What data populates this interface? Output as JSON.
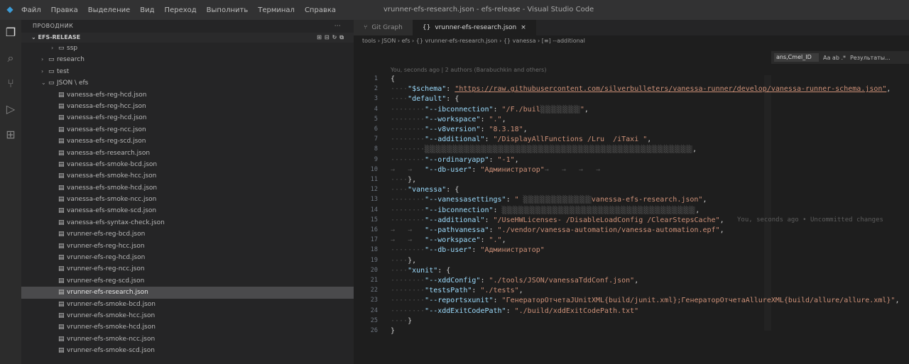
{
  "window": {
    "menu": [
      "Файл",
      "Правка",
      "Выделение",
      "Вид",
      "Переход",
      "Выполнить",
      "Терминал",
      "Справка"
    ],
    "title": "vrunner-efs-research.json - efs-release - Visual Studio Code"
  },
  "sidebar": {
    "title": "ПРОВОДНИК",
    "dots": "···",
    "section": "EFS-RELEASE",
    "section_actions": "⊞⊟↻⧉",
    "items": [
      {
        "label": "ssp",
        "indent": 2,
        "type": "folder"
      },
      {
        "label": "research",
        "indent": 1,
        "type": "folder"
      },
      {
        "label": "test",
        "indent": 1,
        "type": "folder"
      },
      {
        "label": "JSON \\ efs",
        "indent": 1,
        "type": "folder-open"
      },
      {
        "label": "vanessa-efs-reg-hcd.json",
        "indent": 2,
        "type": "file"
      },
      {
        "label": "vanessa-efs-reg-hcc.json",
        "indent": 2,
        "type": "file"
      },
      {
        "label": "vanessa-efs-reg-hcd.json",
        "indent": 2,
        "type": "file"
      },
      {
        "label": "vanessa-efs-reg-ncc.json",
        "indent": 2,
        "type": "file"
      },
      {
        "label": "vanessa-efs-reg-scd.json",
        "indent": 2,
        "type": "file"
      },
      {
        "label": "vanessa-efs-research.json",
        "indent": 2,
        "type": "file"
      },
      {
        "label": "vanessa-efs-smoke-bcd.json",
        "indent": 2,
        "type": "file"
      },
      {
        "label": "vanessa-efs-smoke-hcc.json",
        "indent": 2,
        "type": "file"
      },
      {
        "label": "vanessa-efs-smoke-hcd.json",
        "indent": 2,
        "type": "file"
      },
      {
        "label": "vanessa-efs-smoke-ncc.json",
        "indent": 2,
        "type": "file"
      },
      {
        "label": "vanessa-efs-smoke-scd.json",
        "indent": 2,
        "type": "file"
      },
      {
        "label": "vanessa-efs-syntax-check.json",
        "indent": 2,
        "type": "file"
      },
      {
        "label": "vrunner-efs-reg-bcd.json",
        "indent": 2,
        "type": "file"
      },
      {
        "label": "vrunner-efs-reg-hcc.json",
        "indent": 2,
        "type": "file"
      },
      {
        "label": "vrunner-efs-reg-hcd.json",
        "indent": 2,
        "type": "file"
      },
      {
        "label": "vrunner-efs-reg-ncc.json",
        "indent": 2,
        "type": "file"
      },
      {
        "label": "vrunner-efs-reg-scd.json",
        "indent": 2,
        "type": "file"
      },
      {
        "label": "vrunner-efs-research.json",
        "indent": 2,
        "type": "file",
        "selected": true
      },
      {
        "label": "vrunner-efs-smoke-bcd.json",
        "indent": 2,
        "type": "file"
      },
      {
        "label": "vrunner-efs-smoke-hcc.json",
        "indent": 2,
        "type": "file"
      },
      {
        "label": "vrunner-efs-smoke-hcd.json",
        "indent": 2,
        "type": "file"
      },
      {
        "label": "vrunner-efs-smoke-ncc.json",
        "indent": 2,
        "type": "file"
      },
      {
        "label": "vrunner-efs-smoke-scd.json",
        "indent": 2,
        "type": "file"
      }
    ]
  },
  "tabs": [
    {
      "label": "Git Graph",
      "active": false
    },
    {
      "label": "vrunner-efs-research.json",
      "active": true
    }
  ],
  "breadcrumb": "tools › JSON › efs › {} vrunner-efs-research.json › {} vanessa › [≡] --additional",
  "find": {
    "value": "ans,Cmel_ID",
    "options": "Aa ab .*",
    "right": "Результаты..."
  },
  "blame_header": "You, seconds ago | 2 authors (Barabuchkin and others)",
  "blame_line15": "You, seconds ago • Uncommitted changes",
  "code": [
    [
      [
        "p",
        "{"
      ]
    ],
    [
      [
        "w",
        "····"
      ],
      [
        "k",
        "\"$schema\""
      ],
      [
        "p",
        ": "
      ],
      [
        "url",
        "\"https://raw.githubusercontent.com/silverbulleters/vanessa-runner/develop/vanessa-runner-schema.json\""
      ],
      [
        "p",
        ","
      ]
    ],
    [
      [
        "w",
        "····"
      ],
      [
        "k",
        "\"default\""
      ],
      [
        "p",
        ": {"
      ]
    ],
    [
      [
        "w",
        "········"
      ],
      [
        "k",
        "\"--ibconnection\""
      ],
      [
        "p",
        ": "
      ],
      [
        "s",
        "\"/F./buil"
      ],
      [
        "blur",
        "░░░░░░░"
      ],
      [
        "s",
        "\""
      ],
      [
        "p",
        ","
      ]
    ],
    [
      [
        "w",
        "········"
      ],
      [
        "k",
        "\"--workspace\""
      ],
      [
        "p",
        ": "
      ],
      [
        "s",
        "\".\""
      ],
      [
        "p",
        ","
      ]
    ],
    [
      [
        "w",
        "········"
      ],
      [
        "k",
        "\"--v8version\""
      ],
      [
        "p",
        ": "
      ],
      [
        "s",
        "\"8.3.18\""
      ],
      [
        "p",
        ","
      ]
    ],
    [
      [
        "w",
        "········"
      ],
      [
        "k",
        "\"--additional\""
      ],
      [
        "p",
        ": "
      ],
      [
        "s",
        "\"/DisplayAllFunctions /Lru  /iTaxi \""
      ],
      [
        "p",
        ","
      ]
    ],
    [
      [
        "w",
        "········"
      ],
      [
        "blur",
        "░░░░░░░░░░░░░░░░░░░░░░░░░░░░░░░░░░░░░░░░░░░░░░░"
      ],
      [
        "p",
        ","
      ]
    ],
    [
      [
        "w",
        "········"
      ],
      [
        "k",
        "\"--ordinaryapp\""
      ],
      [
        "p",
        ": "
      ],
      [
        "s",
        "\"-1\""
      ],
      [
        "p",
        ","
      ]
    ],
    [
      [
        "w",
        "→   →   "
      ],
      [
        "k",
        "\"--db-user\""
      ],
      [
        "p",
        ": "
      ],
      [
        "s",
        "\"Администратор\""
      ],
      [
        "w",
        "→   →   →   →"
      ]
    ],
    [
      [
        "w",
        "····"
      ],
      [
        "p",
        "},"
      ]
    ],
    [
      [
        "w",
        "····"
      ],
      [
        "k",
        "\"vanessa\""
      ],
      [
        "p",
        ": {"
      ]
    ],
    [
      [
        "w",
        "········"
      ],
      [
        "k",
        "\"--vanessasettings\""
      ],
      [
        "p",
        ": "
      ],
      [
        "s",
        "\" "
      ],
      [
        "blur",
        "░░░░░░░░░░░░"
      ],
      [
        "s",
        "vanessa-efs-research.json\""
      ],
      [
        "p",
        ","
      ]
    ],
    [
      [
        "w",
        "········"
      ],
      [
        "k",
        "\"--ibconnection\""
      ],
      [
        "p",
        ": "
      ],
      [
        "blur",
        "░░░░░░░░░░░░░░░░░░░░░░░░░░░░░░░░░░"
      ],
      [
        "p",
        ","
      ]
    ],
    [
      [
        "w",
        "········"
      ],
      [
        "k",
        "\"--additional\""
      ],
      [
        "p",
        ": "
      ],
      [
        "s",
        "\"/UseHWLicenses- /DisableLoadConfig /ClearStepsCache\""
      ],
      [
        "p",
        ","
      ]
    ],
    [
      [
        "w",
        "→   →   "
      ],
      [
        "k",
        "\"--pathvanessa\""
      ],
      [
        "p",
        ": "
      ],
      [
        "s",
        "\"./vendor/vanessa-automation/vanessa-automation.epf\""
      ],
      [
        "p",
        ","
      ]
    ],
    [
      [
        "w",
        "→   →   "
      ],
      [
        "k",
        "\"--workspace\""
      ],
      [
        "p",
        ": "
      ],
      [
        "s",
        "\".\""
      ],
      [
        "p",
        ","
      ]
    ],
    [
      [
        "w",
        "········"
      ],
      [
        "k",
        "\"--db-user\""
      ],
      [
        "p",
        ": "
      ],
      [
        "s",
        "\"Администратор\""
      ]
    ],
    [
      [
        "w",
        "····"
      ],
      [
        "p",
        "},"
      ]
    ],
    [
      [
        "w",
        "····"
      ],
      [
        "k",
        "\"xunit\""
      ],
      [
        "p",
        ": {"
      ]
    ],
    [
      [
        "w",
        "········"
      ],
      [
        "k",
        "\"--xddConfig\""
      ],
      [
        "p",
        ": "
      ],
      [
        "s",
        "\"./tools/JSON/vanessaTddConf.json\""
      ],
      [
        "p",
        ","
      ]
    ],
    [
      [
        "w",
        "········"
      ],
      [
        "k",
        "\"testsPath\""
      ],
      [
        "p",
        ": "
      ],
      [
        "s",
        "\"./tests\""
      ],
      [
        "p",
        ","
      ]
    ],
    [
      [
        "w",
        "········"
      ],
      [
        "k",
        "\"--reportsxunit\""
      ],
      [
        "p",
        ": "
      ],
      [
        "s",
        "\"ГенераторОтчетаJUnitXML{build/junit.xml};ГенераторОтчетаAllureXML{build/allure/allure.xml}\""
      ],
      [
        "p",
        ","
      ]
    ],
    [
      [
        "w",
        "········"
      ],
      [
        "k",
        "\"--xddExitCodePath\""
      ],
      [
        "p",
        ": "
      ],
      [
        "s",
        "\"./build/xddExitCodePath.txt\""
      ]
    ],
    [
      [
        "w",
        "····"
      ],
      [
        "p",
        "}"
      ]
    ],
    [
      [
        "p",
        "}"
      ]
    ]
  ]
}
